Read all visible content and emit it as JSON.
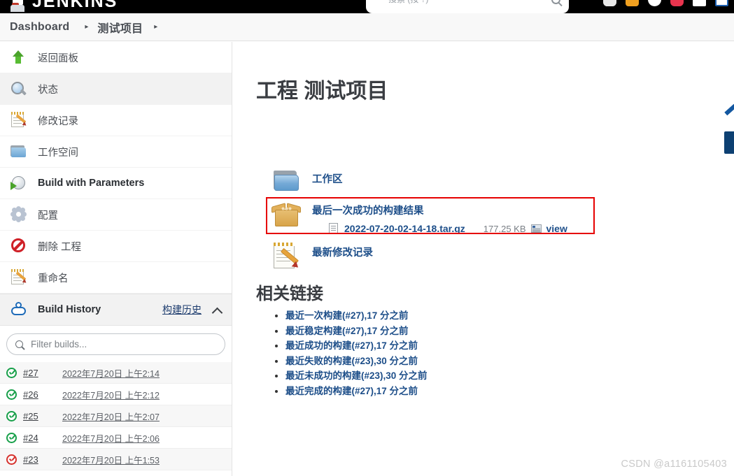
{
  "topbar": {
    "logo_text": "JENKINS",
    "search_placeholder": "搜索 (按 ?)",
    "icons": [
      "bell-icon",
      "orange-badge-icon",
      "white-drop-icon",
      "pink-badge-icon",
      "window-icon",
      "blue-window-icon"
    ]
  },
  "breadcrumb": {
    "items": [
      {
        "label": "Dashboard"
      },
      {
        "label": "测试项目"
      }
    ],
    "separator": "▸"
  },
  "sidebar": {
    "tasks": [
      {
        "label": "返回面板",
        "icon": "up-arrow-icon",
        "active": false
      },
      {
        "label": "状态",
        "icon": "magnifier-icon",
        "active": true
      },
      {
        "label": "修改记录",
        "icon": "notepad-pencil-icon",
        "active": false
      },
      {
        "label": "工作空间",
        "icon": "folder-icon",
        "active": false
      },
      {
        "label": "Build with Parameters",
        "icon": "clock-play-icon",
        "active": false
      },
      {
        "label": "配置",
        "icon": "gear-icon",
        "active": false
      },
      {
        "label": "删除 工程",
        "icon": "no-entry-icon",
        "active": false
      },
      {
        "label": "重命名",
        "icon": "notepad-pencil-icon",
        "active": false
      }
    ],
    "build_history": {
      "title": "Build History",
      "link_label": "构建历史",
      "collapse_icon": "chevron-up-icon",
      "weather_icon": "weather-cloud-icon",
      "filter_placeholder": "Filter builds...",
      "filter_value": "",
      "builds": [
        {
          "number": "#27",
          "date": "2022年7月20日 上午2:14",
          "status": "success"
        },
        {
          "number": "#26",
          "date": "2022年7月20日 上午2:12",
          "status": "success"
        },
        {
          "number": "#25",
          "date": "2022年7月20日 上午2:07",
          "status": "success"
        },
        {
          "number": "#24",
          "date": "2022年7月20日 上午2:06",
          "status": "success"
        },
        {
          "number": "#23",
          "date": "2022年7月20日 上午1:53",
          "status": "failure"
        }
      ]
    }
  },
  "main": {
    "page_title": "工程 测试项目",
    "workspace": {
      "label": "工作区",
      "icon": "folder-icon"
    },
    "last_successful_artifacts": {
      "label": "最后一次成功的构建结果",
      "icon": "package-box-icon",
      "artifact": {
        "name": "2022-07-20-02-14-18.tar.gz",
        "size": "177.25 KB",
        "view_label": "view",
        "doc_icon": "document-icon",
        "view_icon": "view-page-icon"
      },
      "highlighted": true,
      "highlight_color": "#e60000"
    },
    "recent_changes": {
      "label": "最新修改记录",
      "icon": "notepad-pencil-icon"
    },
    "related_links": {
      "heading": "相关链接",
      "items": [
        "最近一次构建(#27),17 分之前",
        "最近稳定构建(#27),17 分之前",
        "最近成功的构建(#27),17 分之前",
        "最近失败的构建(#23),30 分之前",
        "最近未成功的构建(#23),30 分之前",
        "最近完成的构建(#27),17 分之前"
      ]
    }
  },
  "watermark": "CSDN @a1161105403",
  "floating": {
    "pencil_icon": "edit-pencil-widget",
    "block_icon": "side-panel-widget"
  }
}
